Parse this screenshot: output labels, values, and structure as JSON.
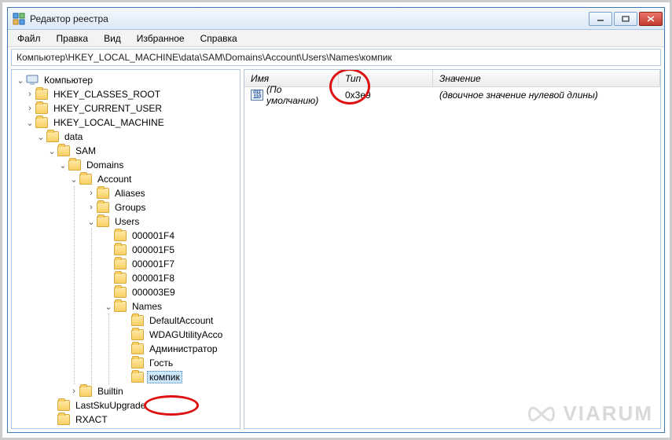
{
  "window": {
    "title": "Редактор реестра"
  },
  "menu": {
    "file": "Файл",
    "edit": "Правка",
    "view": "Вид",
    "favorites": "Избранное",
    "help": "Справка"
  },
  "address": "Компьютер\\HKEY_LOCAL_MACHINE\\data\\SAM\\Domains\\Account\\Users\\Names\\компик",
  "tree": {
    "root": "Компьютер",
    "hkcr": "HKEY_CLASSES_ROOT",
    "hkcu": "HKEY_CURRENT_USER",
    "hklm": "HKEY_LOCAL_MACHINE",
    "data": "data",
    "sam": "SAM",
    "domains": "Domains",
    "account": "Account",
    "aliases": "Aliases",
    "groups": "Groups",
    "users": "Users",
    "u1": "000001F4",
    "u2": "000001F5",
    "u3": "000001F7",
    "u4": "000001F8",
    "u5": "000003E9",
    "names": "Names",
    "n1": "DefaultAccount",
    "n2": "WDAGUtilityAcco",
    "n3": "Администратор",
    "n4": "Гость",
    "n5": "компик",
    "builtin": "Builtin",
    "lastsku": "LastSkuUpgrade",
    "rxact": "RXACT"
  },
  "list": {
    "hdr_name": "Имя",
    "hdr_type": "Тип",
    "hdr_value": "Значение",
    "row0": {
      "name": "(По умолчанию)",
      "type": "0x3e9",
      "value": "(двоичное значение нулевой длины)"
    }
  },
  "watermark": "VIARUM"
}
